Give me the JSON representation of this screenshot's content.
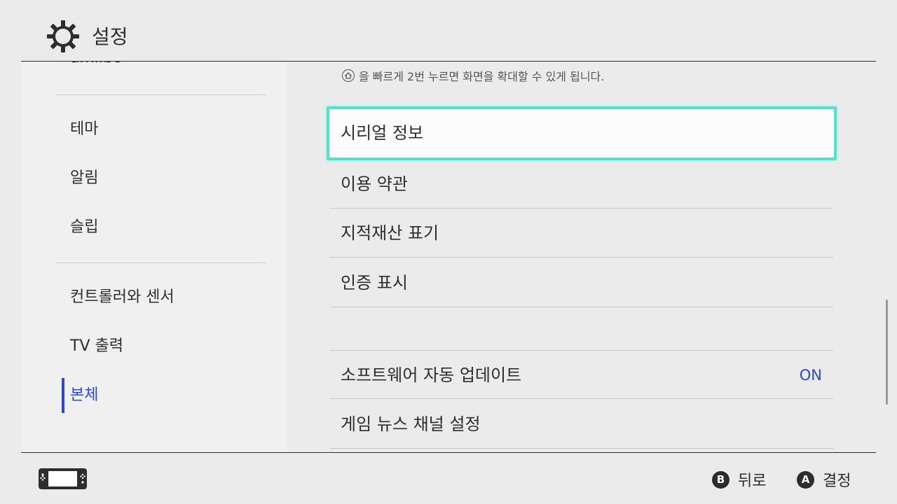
{
  "header": {
    "title": "설정",
    "icon": "gear-icon"
  },
  "sidebar": {
    "partial_item": "amiibo",
    "items": [
      {
        "label": "테마"
      },
      {
        "label": "알림"
      },
      {
        "label": "슬립"
      },
      {
        "label": "컨트롤러와 센서"
      },
      {
        "label": "TV 출력"
      },
      {
        "label": "본체",
        "active": true
      }
    ]
  },
  "main": {
    "hint_text": "을 빠르게 2번 누르면 화면을 확대할 수 있게 됩니다.",
    "rows": [
      {
        "label": "시리얼 정보",
        "selected": true
      },
      {
        "label": "이용 약관"
      },
      {
        "label": "지적재산 표기"
      },
      {
        "label": "인증 표시"
      },
      {
        "label": "소프트웨어 자동 업데이트",
        "value": "ON"
      },
      {
        "label": "게임 뉴스 채널 설정"
      }
    ]
  },
  "footer": {
    "back": {
      "button": "B",
      "label": "뒤로"
    },
    "confirm": {
      "button": "A",
      "label": "결정"
    }
  },
  "colors": {
    "accent": "#2a47d8",
    "selection": "#4de3cf",
    "background": "#ebebeb"
  }
}
